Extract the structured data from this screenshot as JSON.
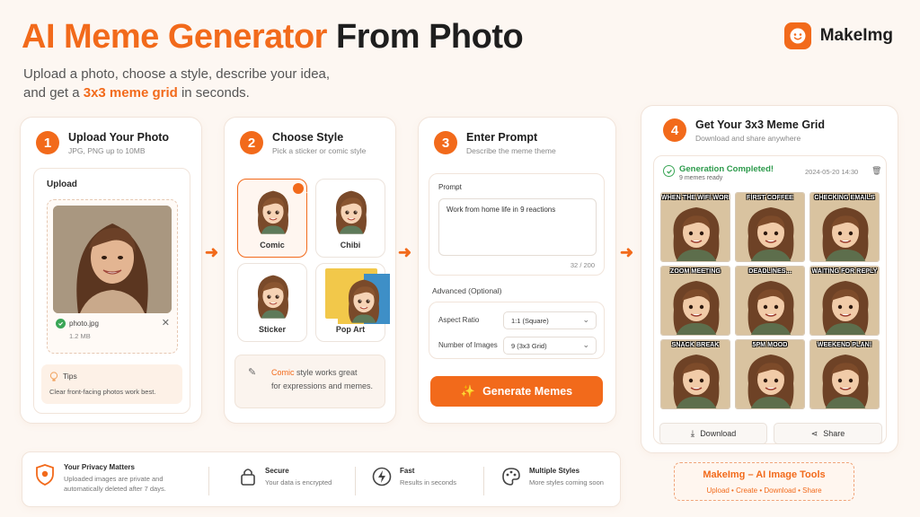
{
  "hero": {
    "title_part1": "AI Meme Generator",
    "title_part2": "From Photo",
    "sub_line1": "Upload a photo, choose a style, describe your idea,",
    "sub_line2_pre": "and get a",
    "sub_line2_highlight": "3x3 meme grid",
    "sub_line2_post": "in seconds."
  },
  "brand": {
    "name": "MakeImg",
    "logo_icon": "smiley-face-icon",
    "accent": "#f26a1b"
  },
  "step1": {
    "number": "1",
    "title": "Upload Your Photo",
    "desc": "JPG, PNG up to 10MB",
    "upload_label": "Upload",
    "file_name": "photo.jpg",
    "file_size": "1.2 MB",
    "tips_title": "Tips",
    "tips_text": "Clear front-facing photos work best."
  },
  "step2": {
    "number": "2",
    "title": "Choose Style",
    "desc": "Pick a sticker or comic style",
    "styles": [
      {
        "label": "Comic",
        "selected": true
      },
      {
        "label": "Chibi",
        "selected": false
      },
      {
        "label": "Sticker",
        "selected": false
      },
      {
        "label": "Pop Art",
        "selected": false
      }
    ],
    "hint_bold": "Comic",
    "hint_line1": "style works great",
    "hint_line2": "for expressions and memes."
  },
  "step3": {
    "number": "3",
    "title": "Enter Prompt",
    "desc": "Describe the meme theme",
    "prompt_label": "Prompt",
    "prompt_value": "Work from home life in 9 reactions",
    "char_count": "32 / 200",
    "advanced_label": "Advanced (Optional)",
    "aspect_label": "Aspect Ratio",
    "aspect_value": "1:1 (Square)",
    "count_label": "Number of Images",
    "count_value": "9 (3x3 Grid)",
    "button_label": "Generate Memes"
  },
  "step4": {
    "number": "4",
    "title": "Get Your 3x3 Meme Grid",
    "desc": "Download and share anywhere",
    "status": "Generation Completed!",
    "status_sub": "9 memes ready",
    "timestamp": "2024-05-20 14:30",
    "memes": [
      "WHEN THE WIFI WORKS",
      "FIRST COFFEE",
      "CHECKING EMAILS",
      "ZOOM MEETING",
      "DEADLINES...",
      "WAITING FOR REPLY",
      "SNACK BREAK",
      "5PM MOOD",
      "WEEKEND PLAN!"
    ],
    "download_label": "Download",
    "share_label": "Share"
  },
  "features": [
    {
      "title": "Your Privacy Matters",
      "desc_line1": "Uploaded images are private and",
      "desc_line2": "automatically deleted after 7 days.",
      "icon": "shield-icon"
    },
    {
      "title": "Secure",
      "desc_line1": "Your data is encrypted",
      "icon": "lock-icon"
    },
    {
      "title": "Fast",
      "desc_line1": "Results in seconds",
      "icon": "lightning-icon"
    },
    {
      "title": "Multiple Styles",
      "desc_line1": "More styles coming soon",
      "icon": "palette-icon"
    }
  ],
  "promo": {
    "title": "MakeImg – AI Image Tools",
    "links": "Upload • Create • Download • Share"
  }
}
